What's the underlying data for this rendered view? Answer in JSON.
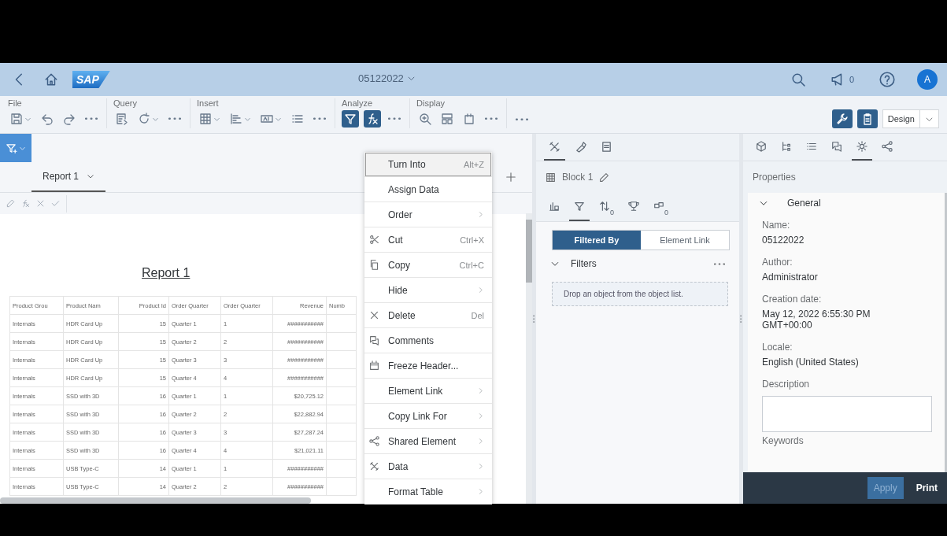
{
  "shell": {
    "logo": "SAP",
    "title": "05122022",
    "notification_count": "0",
    "avatar": "A"
  },
  "toolbar": {
    "groups": [
      {
        "label": "File",
        "buttons": [
          {
            "kind": "save",
            "dropdown": true,
            "on": false
          },
          {
            "kind": "undo",
            "dropdown": false,
            "on": false
          },
          {
            "kind": "redo",
            "dropdown": false,
            "on": false
          },
          {
            "kind": "more",
            "dropdown": false,
            "on": false
          }
        ]
      },
      {
        "label": "Query",
        "buttons": [
          {
            "kind": "query",
            "dropdown": false,
            "on": false
          },
          {
            "kind": "refresh",
            "dropdown": true,
            "on": false
          },
          {
            "kind": "more",
            "dropdown": false,
            "on": false
          }
        ]
      },
      {
        "label": "Insert",
        "buttons": [
          {
            "kind": "table",
            "dropdown": true,
            "on": false
          },
          {
            "kind": "chart",
            "dropdown": true,
            "on": false
          },
          {
            "kind": "textbox",
            "dropdown": true,
            "on": false
          },
          {
            "kind": "list",
            "dropdown": false,
            "on": false
          },
          {
            "kind": "more",
            "dropdown": false,
            "on": false
          }
        ]
      },
      {
        "label": "Analyze",
        "buttons": [
          {
            "kind": "filter",
            "dropdown": false,
            "on": true
          },
          {
            "kind": "formula",
            "dropdown": false,
            "on": true
          },
          {
            "kind": "more",
            "dropdown": false,
            "on": false
          }
        ]
      },
      {
        "label": "Display",
        "buttons": [
          {
            "kind": "zoom",
            "dropdown": false,
            "on": false
          },
          {
            "kind": "layout",
            "dropdown": false,
            "on": false
          },
          {
            "kind": "page-new",
            "dropdown": false,
            "on": false
          },
          {
            "kind": "more",
            "dropdown": false,
            "on": false
          }
        ]
      }
    ],
    "extra_buttons": [
      {
        "kind": "more",
        "dropdown": false,
        "on": false
      }
    ],
    "right_buttons": [
      {
        "kind": "wrench",
        "dropdown": false,
        "on": true
      },
      {
        "kind": "clipboard",
        "dropdown": false,
        "on": true
      }
    ],
    "mode": "Design"
  },
  "report": {
    "tabs": [
      {
        "label": "Report 1",
        "selected": true
      }
    ],
    "title": "Report 1",
    "table": {
      "columns": [
        "Product Grou",
        "Product Nam",
        "Product Id",
        "Order Quarter",
        "Order Quarter",
        "Revenue",
        "Numb"
      ],
      "rows": [
        [
          "Internals",
          "HDR Card Up",
          "15",
          "Quarter 1",
          "1",
          "###########"
        ],
        [
          "Internals",
          "HDR Card Up",
          "15",
          "Quarter 2",
          "2",
          "###########"
        ],
        [
          "Internals",
          "HDR Card Up",
          "15",
          "Quarter 3",
          "3",
          "###########"
        ],
        [
          "Internals",
          "HDR Card Up",
          "15",
          "Quarter 4",
          "4",
          "###########"
        ],
        [
          "Internals",
          "SSD with 3D",
          "16",
          "Quarter 1",
          "1",
          "$20,725.12"
        ],
        [
          "Internals",
          "SSD with 3D",
          "16",
          "Quarter 2",
          "2",
          "$22,882.94"
        ],
        [
          "Internals",
          "SSD with 3D",
          "16",
          "Quarter 3",
          "3",
          "$27,287.24"
        ],
        [
          "Internals",
          "SSD with 3D",
          "16",
          "Quarter 4",
          "4",
          "$21,021.11"
        ],
        [
          "Internals",
          "USB Type-C",
          "14",
          "Quarter 1",
          "1",
          "###########"
        ],
        [
          "Internals",
          "USB Type-C",
          "14",
          "Quarter 2",
          "2",
          "###########"
        ]
      ]
    }
  },
  "context_menu": [
    {
      "label": "Turn Into",
      "shortcut": "Alt+Z",
      "submenu": false,
      "kind": "plain",
      "selected": true
    },
    {
      "label": "Assign Data",
      "submenu": false,
      "kind": "plain",
      "selected": false
    },
    {
      "label": "Order",
      "submenu": true,
      "kind": "plain",
      "selected": false
    },
    {
      "label": "Cut",
      "shortcut": "Ctrl+X",
      "submenu": false,
      "kind": "cut",
      "selected": false
    },
    {
      "label": "Copy",
      "shortcut": "Ctrl+C",
      "submenu": false,
      "kind": "copy",
      "selected": false
    },
    {
      "label": "Hide",
      "submenu": true,
      "kind": "plain",
      "selected": false
    },
    {
      "label": "Delete",
      "shortcut": "Del",
      "submenu": false,
      "kind": "delete",
      "selected": false
    },
    {
      "label": "Comments",
      "submenu": false,
      "kind": "comments",
      "selected": false
    },
    {
      "label": "Freeze Header...",
      "submenu": false,
      "kind": "freeze",
      "selected": false
    },
    {
      "label": "Element Link",
      "submenu": true,
      "kind": "plain",
      "selected": false
    },
    {
      "label": "Copy Link For",
      "submenu": true,
      "kind": "plain",
      "selected": false
    },
    {
      "label": "Shared Element",
      "submenu": true,
      "kind": "share",
      "selected": false
    },
    {
      "label": "Data",
      "submenu": true,
      "kind": "data",
      "selected": false
    },
    {
      "label": "Format Table",
      "submenu": true,
      "kind": "plain",
      "selected": false
    }
  ],
  "build_panel": {
    "tabs": [
      {
        "kind": "tools",
        "selected": true
      },
      {
        "kind": "brush",
        "selected": false
      },
      {
        "kind": "page",
        "selected": false
      }
    ],
    "block": {
      "label": "Block 1"
    },
    "sub_tabs": [
      {
        "kind": "chart-table",
        "selected": false
      },
      {
        "kind": "filter",
        "selected": true
      },
      {
        "kind": "sort",
        "count": "0",
        "selected": false
      },
      {
        "kind": "trophy",
        "selected": false
      },
      {
        "kind": "objects",
        "count": "0",
        "selected": false
      }
    ],
    "segments": [
      {
        "label": "Filtered By",
        "selected": true
      },
      {
        "label": "Element Link",
        "selected": false
      }
    ],
    "filters": {
      "label": "Filters",
      "expanded": true,
      "drop_hint": "Drop an object from the object list."
    }
  },
  "properties_panel": {
    "tabs": [
      {
        "kind": "cube",
        "selected": false
      },
      {
        "kind": "tree",
        "selected": false
      },
      {
        "kind": "list",
        "selected": false
      },
      {
        "kind": "comments",
        "selected": false
      },
      {
        "kind": "gear",
        "selected": true
      },
      {
        "kind": "share",
        "selected": false
      }
    ],
    "title": "Properties",
    "section": {
      "title": "General",
      "expanded": true,
      "fields": [
        {
          "label": "Name:",
          "value": "05122022"
        },
        {
          "label": "Author:",
          "value": "Administrator"
        },
        {
          "label": "Creation date:",
          "value": "May 12, 2022 6:55:30 PM GMT+00:00"
        },
        {
          "label": "Locale:",
          "value": "English (United States)"
        }
      ],
      "description_label": "Description",
      "keywords_label": "Keywords"
    },
    "footer": [
      {
        "label": "Apply",
        "disabled": true
      },
      {
        "label": "Print",
        "disabled": false
      }
    ]
  }
}
